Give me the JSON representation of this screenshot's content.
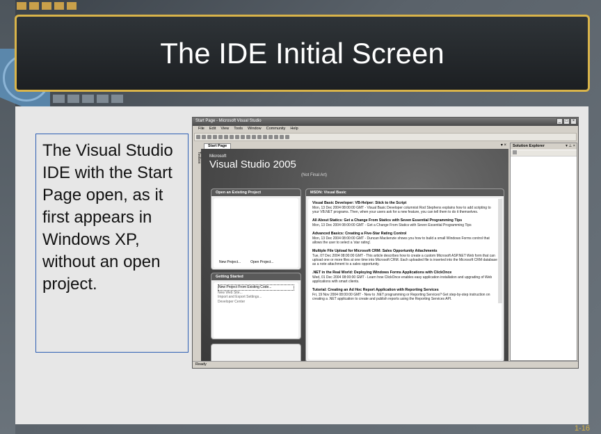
{
  "slide": {
    "title": "The IDE Initial Screen",
    "body": "The Visual Studio IDE with the Start Page open, as it first appears in Windows XP, without an open project.",
    "number": "1-16",
    "accent_color": "#d9b44a"
  },
  "vs": {
    "window_title": "Start Page - Microsoft Visual Studio",
    "menu": [
      "File",
      "Edit",
      "View",
      "Tools",
      "Window",
      "Community",
      "Help"
    ],
    "doc_tab": "Start Page",
    "toolbox_label": "Toolbox",
    "logo": {
      "ms": "Microsoft",
      "name": "Visual Studio 2005",
      "note": "(Not Final Art)"
    },
    "open_panel": {
      "title": "Open an Existing Project",
      "new_project": "New Project...",
      "open_project": "Open Project..."
    },
    "getting_started": {
      "title": "Getting Started",
      "items": [
        "New Project From Existing Code...",
        "New Web Site...",
        "Import and Export Settings...",
        "Developer Center"
      ]
    },
    "msdn": {
      "title": "MSDN: Visual Basic",
      "items": [
        {
          "title": "Visual Basic Developer: VB-Helper: Stick to the Script",
          "desc": "Mon, 13 Dec 2004 08:00:00 GMT - Visual Basic Developer columnist Rod Stephens explains how to add scripting to your VB.NET programs. Then, when your users ask for a new feature, you can tell them to do it themselves."
        },
        {
          "title": "All About Statics: Get a Change From Statics with Seven Essential Programming Tips",
          "desc": "Mon, 13 Dec 2004 08:00:00 GMT - Get a Change From Statics with Seven Essential Programming Tips"
        },
        {
          "title": "Advanced Basics: Creating a Five-Star Rating Control",
          "desc": "Mon, 13 Dec 2004 08:00:00 GMT - Duncan Mackenzie shows you how to build a small Windows Forms control that allows the user to select a 'star rating'."
        },
        {
          "title": "Multiple File Upload for Microsoft CRM: Sales Opportunity Attachments",
          "desc": "Tue, 07 Dec 2004 08:00:00 GMT - This article describes how to create a custom Microsoft ASP.NET Web form that can upload one or more files at one time into Microsoft CRM. Each uploaded file is inserted into the Microsoft CRM database as a note attachment to a sales opportunity."
        },
        {
          "title": ".NET in the Real World: Deploying Windows Forms Applications with ClickOnce",
          "desc": "Wed, 01 Dec 2004 08:00:00 GMT - Learn how ClickOnce enables easy application installation and upgrading of Web applications with smart clients."
        },
        {
          "title": "Tutorial: Creating an Ad Hoc Report Application with Reporting Services",
          "desc": "Fri, 19 Nov 2004 08:00:00 GMT - New to .NET programming or Reporting Services? Get step-by-step instruction on creating a .NET application to create and publish reports using the Reporting Services API."
        }
      ]
    },
    "solution_explorer": "Solution Explorer",
    "status": "Ready"
  }
}
